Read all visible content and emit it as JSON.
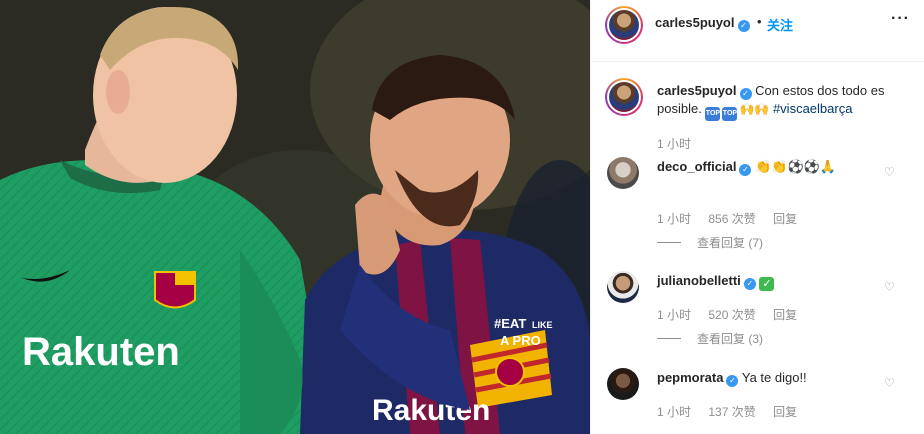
{
  "post": {
    "username": "carles5puyol",
    "follow_label": "关注",
    "dot": "•",
    "more_icon": "more-horizontal-icon",
    "caption_text": "Con estos dos todo es posible.",
    "caption_emoji_text": "🙌🙌",
    "caption_top_label": "TOP",
    "caption_hashtag": "#viscaelbarça",
    "time": "1 小时",
    "photo_text": {
      "sponsor": "Rakuten",
      "sponsor_back": "Rakuten",
      "sleeve_line1": "#EAT",
      "sleeve_line2": "LIKE",
      "sleeve_line3": "A PRO"
    }
  },
  "comments": [
    {
      "username": "deco_official",
      "text": "👏👏⚽⚽🙏",
      "text_line2": "🙏",
      "time": "1 小时",
      "likes": "856 次赞",
      "reply": "回复",
      "view_replies": "查看回复 (7)"
    },
    {
      "username": "julianobelletti",
      "text": "✓",
      "time": "1 小时",
      "likes": "520 次赞",
      "reply": "回复",
      "view_replies": "查看回复 (3)"
    },
    {
      "username": "pepmorata",
      "text": "Ya te digo!!",
      "time": "1 小时",
      "likes": "137 次赞",
      "reply": "回复"
    }
  ],
  "colors": {
    "accent": "#0095f6",
    "verified": "#3897f0",
    "muted": "#8e8e8e"
  }
}
